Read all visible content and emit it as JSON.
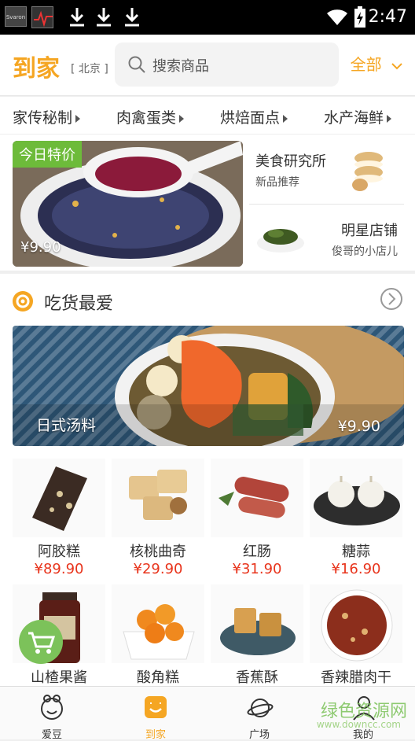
{
  "status_bar": {
    "app_thumb_text": "Svaron",
    "time": "2:47"
  },
  "header": {
    "logo": "到家",
    "city": "[ 北京 ]",
    "search_placeholder": "搜索商品",
    "filter_label": "全部"
  },
  "categories": [
    "家传秘制",
    "肉禽蛋类",
    "烘焙面点",
    "水产海鲜"
  ],
  "promo": {
    "special_tag": "今日特价",
    "special_price": "¥9.90",
    "card1_title": "美食研究所",
    "card1_sub": "新品推荐",
    "card2_title": "明星店铺",
    "card2_sub": "俊哥的小店儿"
  },
  "section": {
    "title": "吃货最爱",
    "banner_name": "日式汤料",
    "banner_price": "¥9.90"
  },
  "products": [
    {
      "name": "阿胶糕",
      "price": "¥89.90"
    },
    {
      "name": "核桃曲奇",
      "price": "¥29.90"
    },
    {
      "name": "红肠",
      "price": "¥31.90"
    },
    {
      "name": "糖蒜",
      "price": "¥16.90"
    },
    {
      "name": "山楂果酱",
      "price": ""
    },
    {
      "name": "酸角糕",
      "price": ""
    },
    {
      "name": "香蕉酥",
      "price": ""
    },
    {
      "name": "香辣腊肉干",
      "price": ""
    }
  ],
  "tabs": [
    {
      "label": "爱豆"
    },
    {
      "label": "到家"
    },
    {
      "label": "广场"
    },
    {
      "label": "我的"
    }
  ],
  "watermark": {
    "title": "绿色资源网",
    "url": "www.downcc.com"
  },
  "colors": {
    "accent": "#f5a623",
    "price": "#e8341c",
    "green": "#6dbb3a"
  }
}
